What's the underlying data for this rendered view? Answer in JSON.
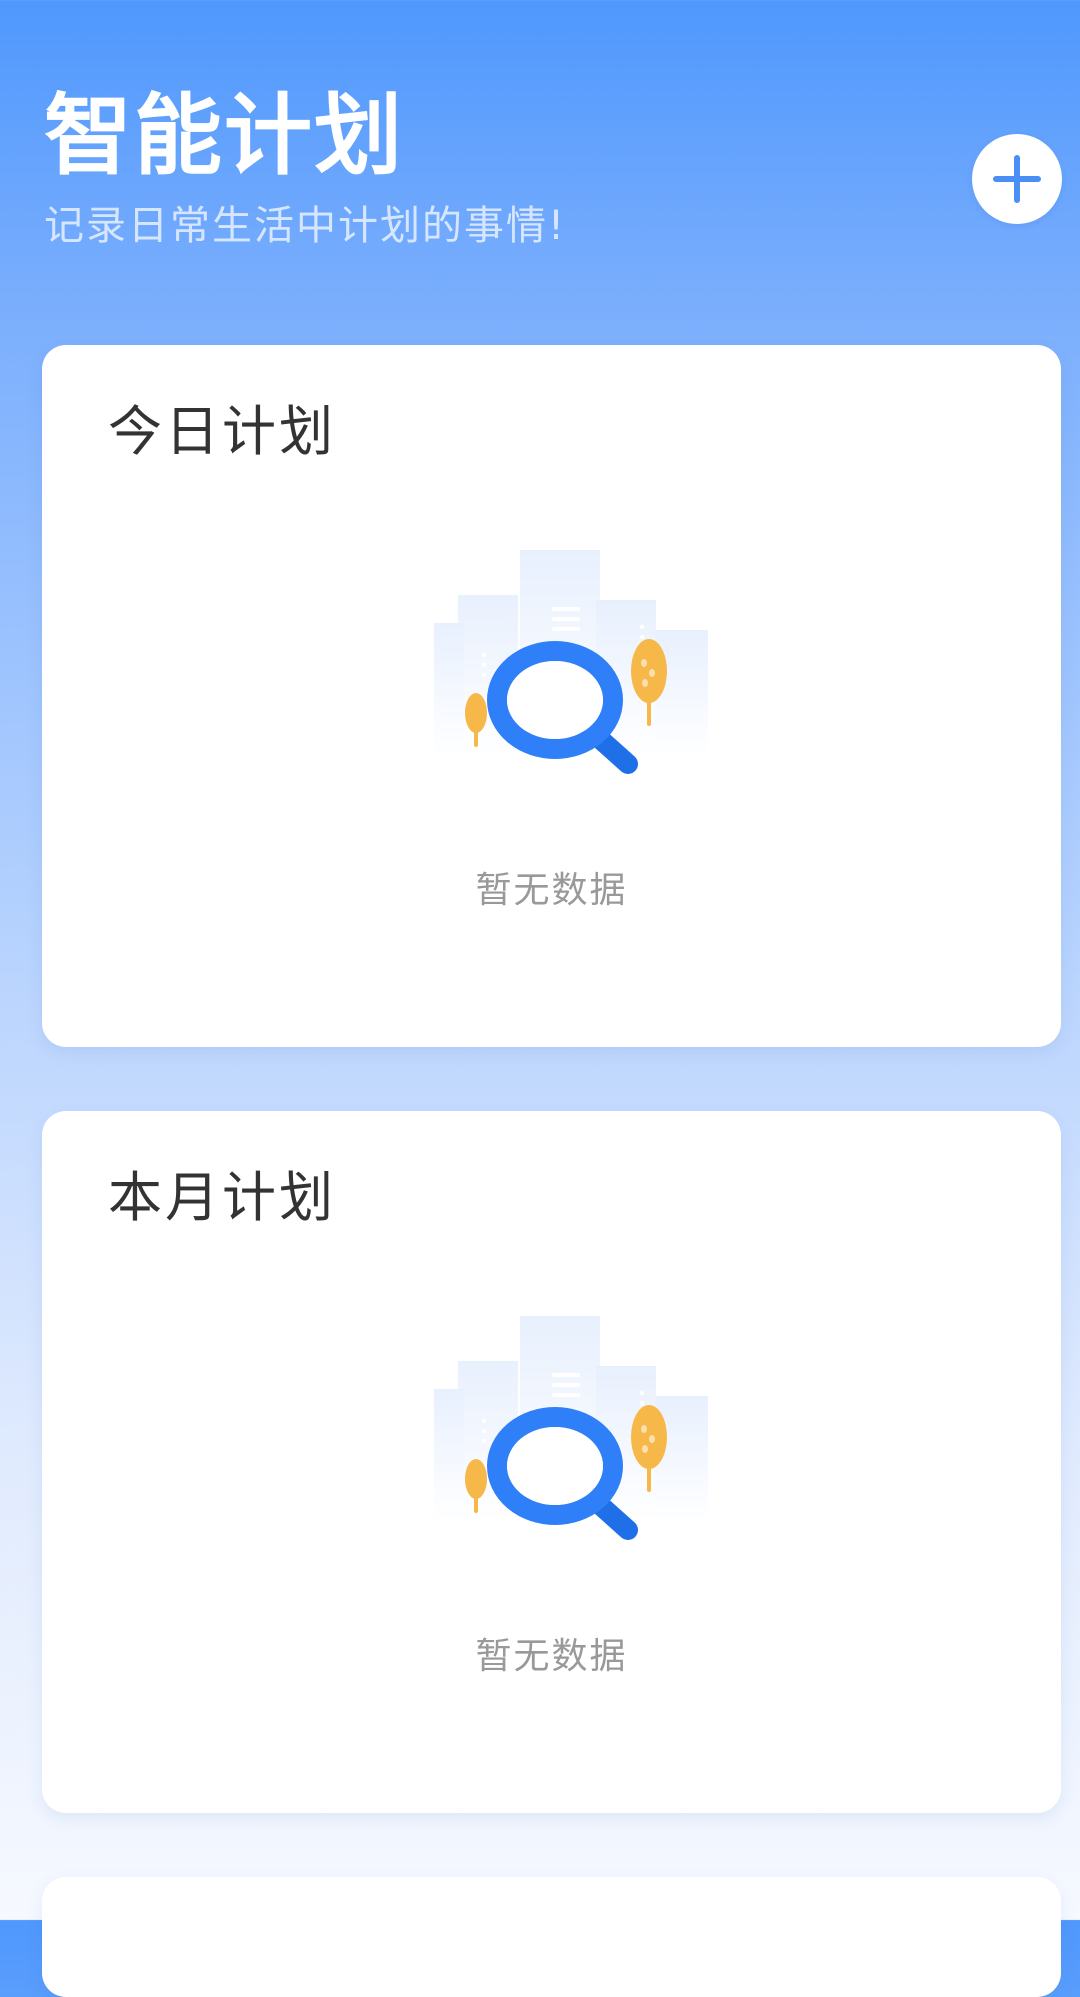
{
  "header": {
    "title": "智能计划",
    "subtitle": "记录日常生活中计划的事情!",
    "add_icon": "plus-icon"
  },
  "cards": [
    {
      "title": "今日计划",
      "empty_text": "暂无数据",
      "empty_icon": "empty-search-illustration"
    },
    {
      "title": "本月计划",
      "empty_text": "暂无数据",
      "empty_icon": "empty-search-illustration"
    }
  ],
  "colors": {
    "accent": "#4f98fd",
    "gradient_top": "#4f98fd",
    "gradient_bottom": "#f6f9ff",
    "card_bg": "#ffffff",
    "title_text": "#333333",
    "muted_text": "#999999",
    "illustration_blue": "#2e7ff8",
    "illustration_tree": "#f7b84a"
  }
}
